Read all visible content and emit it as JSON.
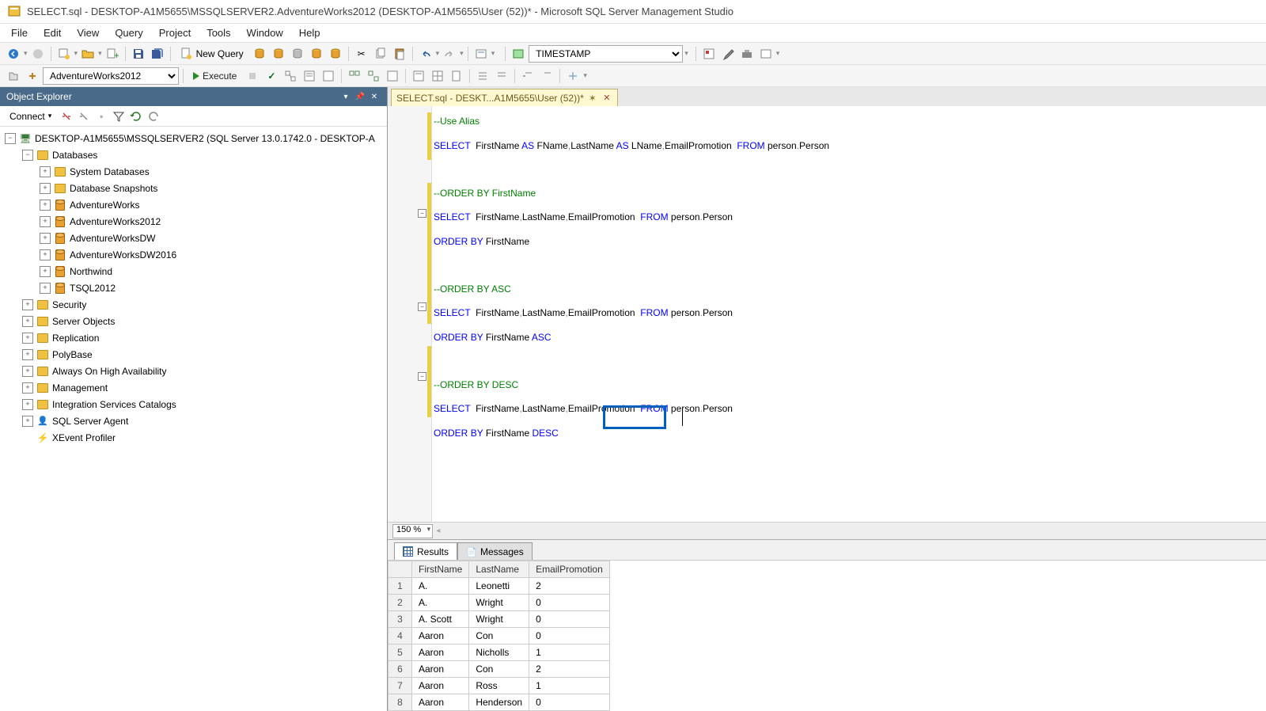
{
  "title": "SELECT.sql - DESKTOP-A1M5655\\MSSQLSERVER2.AdventureWorks2012 (DESKTOP-A1M5655\\User (52))* - Microsoft SQL Server Management Studio",
  "menu": [
    "File",
    "Edit",
    "View",
    "Query",
    "Project",
    "Tools",
    "Window",
    "Help"
  ],
  "toolbar1": {
    "new_query": "New Query",
    "timestamp": "TIMESTAMP"
  },
  "toolbar2": {
    "database": "AdventureWorks2012",
    "execute": "Execute"
  },
  "object_explorer": {
    "title": "Object Explorer",
    "connect": "Connect",
    "server": "DESKTOP-A1M5655\\MSSQLSERVER2 (SQL Server 13.0.1742.0 - DESKTOP-A",
    "folders": {
      "databases": "Databases",
      "sys_db": "System Databases",
      "db_snap": "Database Snapshots",
      "security": "Security",
      "server_obj": "Server Objects",
      "replication": "Replication",
      "polybase": "PolyBase",
      "always_on": "Always On High Availability",
      "management": "Management",
      "int_svc": "Integration Services Catalogs",
      "agent": "SQL Server Agent",
      "xevent": "XEvent Profiler"
    },
    "dbs": [
      "AdventureWorks",
      "AdventureWorks2012",
      "AdventureWorksDW",
      "AdventureWorksDW2016",
      "Northwind",
      "TSQL2012"
    ]
  },
  "tab": {
    "label": "SELECT.sql - DESKT...A1M5655\\User (52))*"
  },
  "code": {
    "c1": "--Use Alias",
    "l2a": "SELECT",
    "l2b": "  FirstName ",
    "l2c": "AS",
    "l2d": " FName",
    "l2e": ",",
    "l2f": "LastName ",
    "l2g": "AS",
    "l2h": " LName",
    "l2i": ",",
    "l2j": "EmailPromotion  ",
    "l2k": "FROM",
    "l2l": " person",
    "l2m": ".",
    "l2n": "Person",
    "c3": "--ORDER BY FirstName",
    "l4a": "SELECT",
    "l4b": "  FirstName",
    "l4c": ",",
    "l4d": "LastName",
    "l4e": ",",
    "l4f": "EmailPromotion  ",
    "l4g": "FROM",
    "l4h": " person",
    "l4i": ".",
    "l4j": "Person",
    "l5a": "ORDER",
    "l5b": " ",
    "l5c": "BY",
    "l5d": " FirstName",
    "c6": "--ORDER BY ASC",
    "l7a": "SELECT",
    "l7b": "  FirstName",
    "l7c": ",",
    "l7d": "LastName",
    "l7e": ",",
    "l7f": "EmailPromotion  ",
    "l7g": "FROM",
    "l7h": " person",
    "l7i": ".",
    "l7j": "Person",
    "l8a": "ORDER",
    "l8b": " ",
    "l8c": "BY",
    "l8d": " FirstName ",
    "l8e": "ASC",
    "c9": "--ORDER BY DESC",
    "l10a": "SELECT",
    "l10b": "  FirstName",
    "l10c": ",",
    "l10d": "LastName",
    "l10e": ",",
    "l10f": "EmailPromotion  ",
    "l10g": "FROM",
    "l10h": " person",
    "l10i": ".",
    "l10j": "Person",
    "l11a": "ORDER",
    "l11b": " ",
    "l11c": "BY",
    "l11d": " FirstName ",
    "l11e": "DESC"
  },
  "zoom": "150 %",
  "results": {
    "tab_results": "Results",
    "tab_messages": "Messages",
    "columns": [
      "",
      "FirstName",
      "LastName",
      "EmailPromotion"
    ],
    "rows": [
      [
        "1",
        "A.",
        "Leonetti",
        "2"
      ],
      [
        "2",
        "A.",
        "Wright",
        "0"
      ],
      [
        "3",
        "A. Scott",
        "Wright",
        "0"
      ],
      [
        "4",
        "Aaron",
        "Con",
        "0"
      ],
      [
        "5",
        "Aaron",
        "Nicholls",
        "1"
      ],
      [
        "6",
        "Aaron",
        "Con",
        "2"
      ],
      [
        "7",
        "Aaron",
        "Ross",
        "1"
      ],
      [
        "8",
        "Aaron",
        "Henderson",
        "0"
      ]
    ]
  }
}
